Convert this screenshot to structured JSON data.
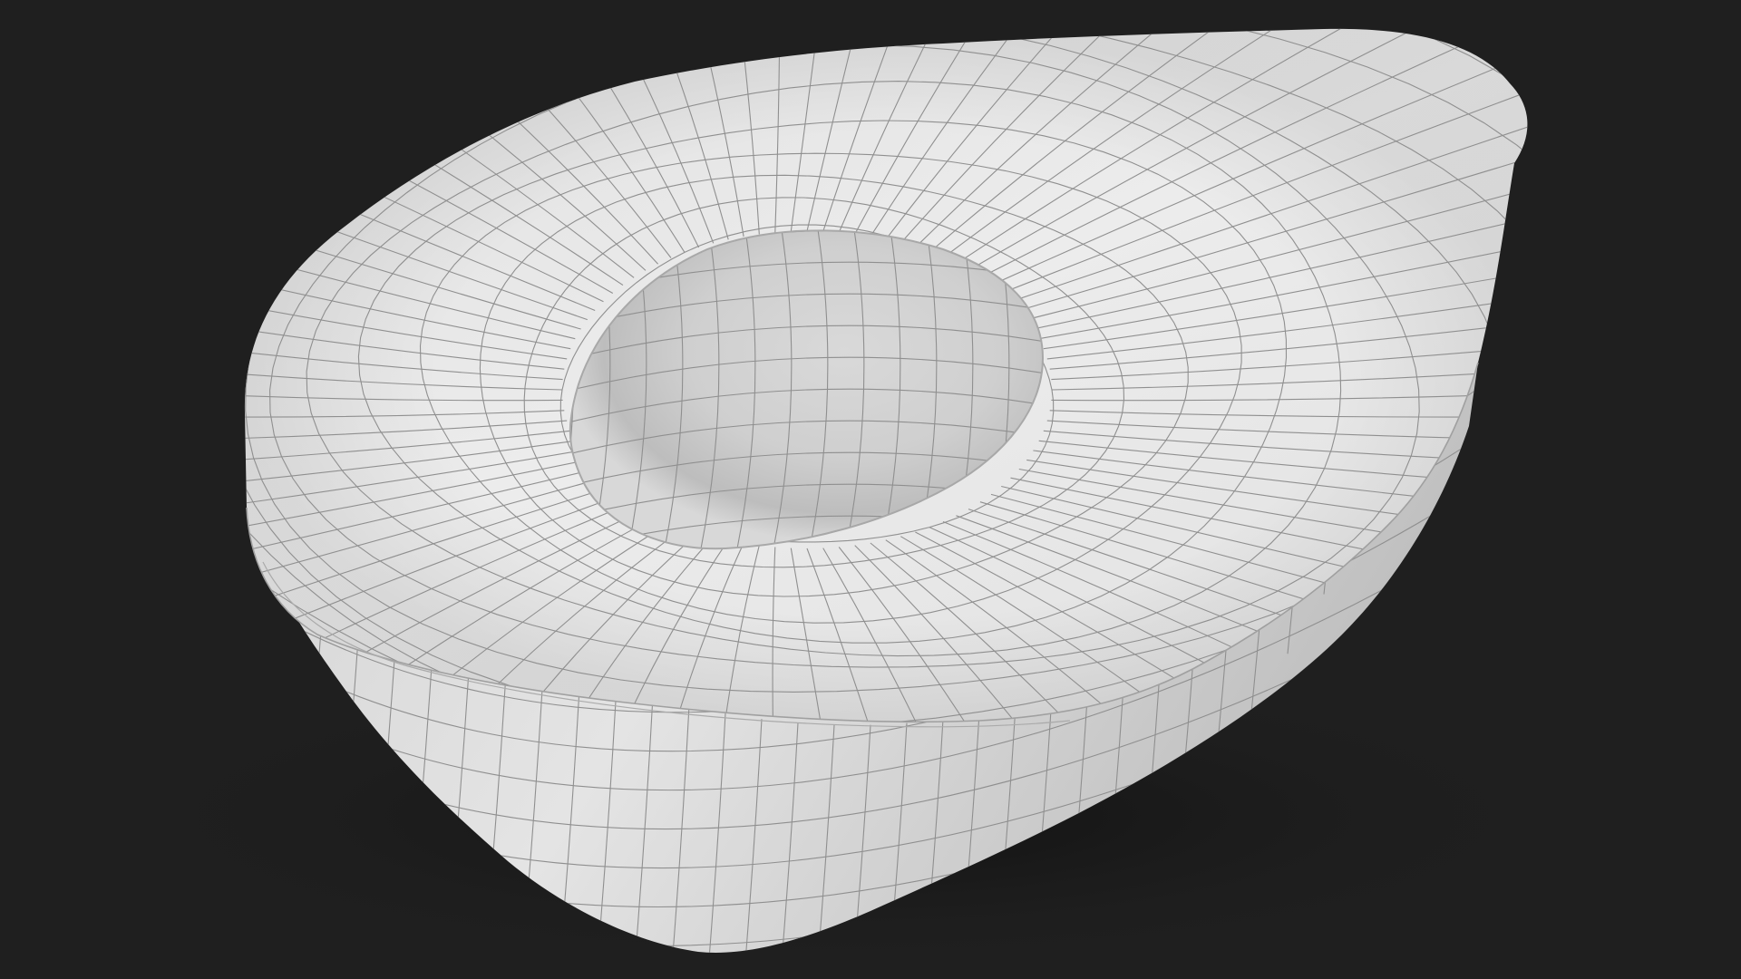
{
  "scene": {
    "subject": "half-avocado-mesh",
    "render_mode": "wireframe-on-shaded",
    "colors": {
      "background": "#1f1f1f",
      "surface_light": "#ececec",
      "surface_mid": "#d6d6d6",
      "surface_dark": "#b9b9b9",
      "pit_shadow": "#c6c6c6",
      "wire": "#8f8f8f",
      "ground_shadow": "#141414"
    }
  }
}
